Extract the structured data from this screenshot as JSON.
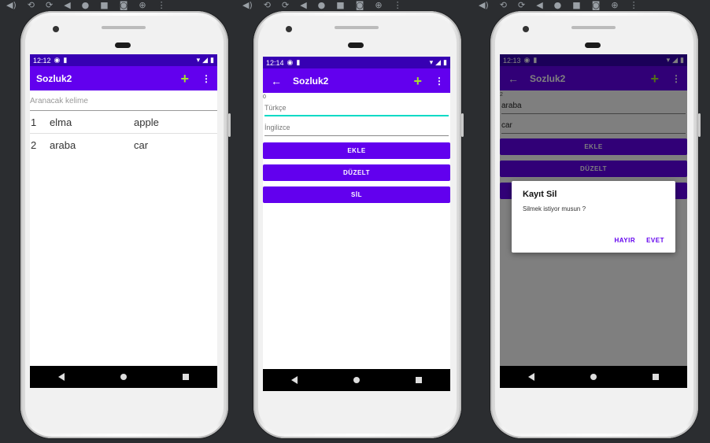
{
  "phones": [
    {
      "status": {
        "time": "12:12"
      },
      "appbar": {
        "title": "Sozluk2",
        "plus_icon": "plus-icon",
        "more_icon": "more-vert-icon"
      },
      "search": {
        "placeholder": "Aranacak kelime"
      },
      "list": [
        {
          "num": "1",
          "tr": "elma",
          "en": "apple"
        },
        {
          "num": "2",
          "tr": "araba",
          "en": "car"
        }
      ]
    },
    {
      "status": {
        "time": "12:14"
      },
      "appbar": {
        "title": "Sozluk2",
        "back_icon": "arrow-back-icon"
      },
      "id_value": "0",
      "turkish": {
        "placeholder": "Türkçe"
      },
      "english": {
        "placeholder": "İngilizce"
      },
      "buttons": {
        "add": "EKLE",
        "edit": "DÜZELT",
        "delete": "SİL"
      }
    },
    {
      "status": {
        "time": "12:13"
      },
      "appbar": {
        "title": "Sozluk2"
      },
      "id_value": "2",
      "turkish": {
        "value": "araba"
      },
      "english": {
        "value": "car"
      },
      "buttons": {
        "add": "EKLE",
        "edit": "DÜZELT"
      },
      "dialog": {
        "title": "Kayıt Sil",
        "message": "Silmek istiyor musun ?",
        "no": "HAYIR",
        "yes": "EVET"
      }
    }
  ],
  "colors": {
    "primary": "#6200ee",
    "primary_dark": "#3700b3",
    "accent": "#a6e22e",
    "teal": "#03dac5"
  }
}
